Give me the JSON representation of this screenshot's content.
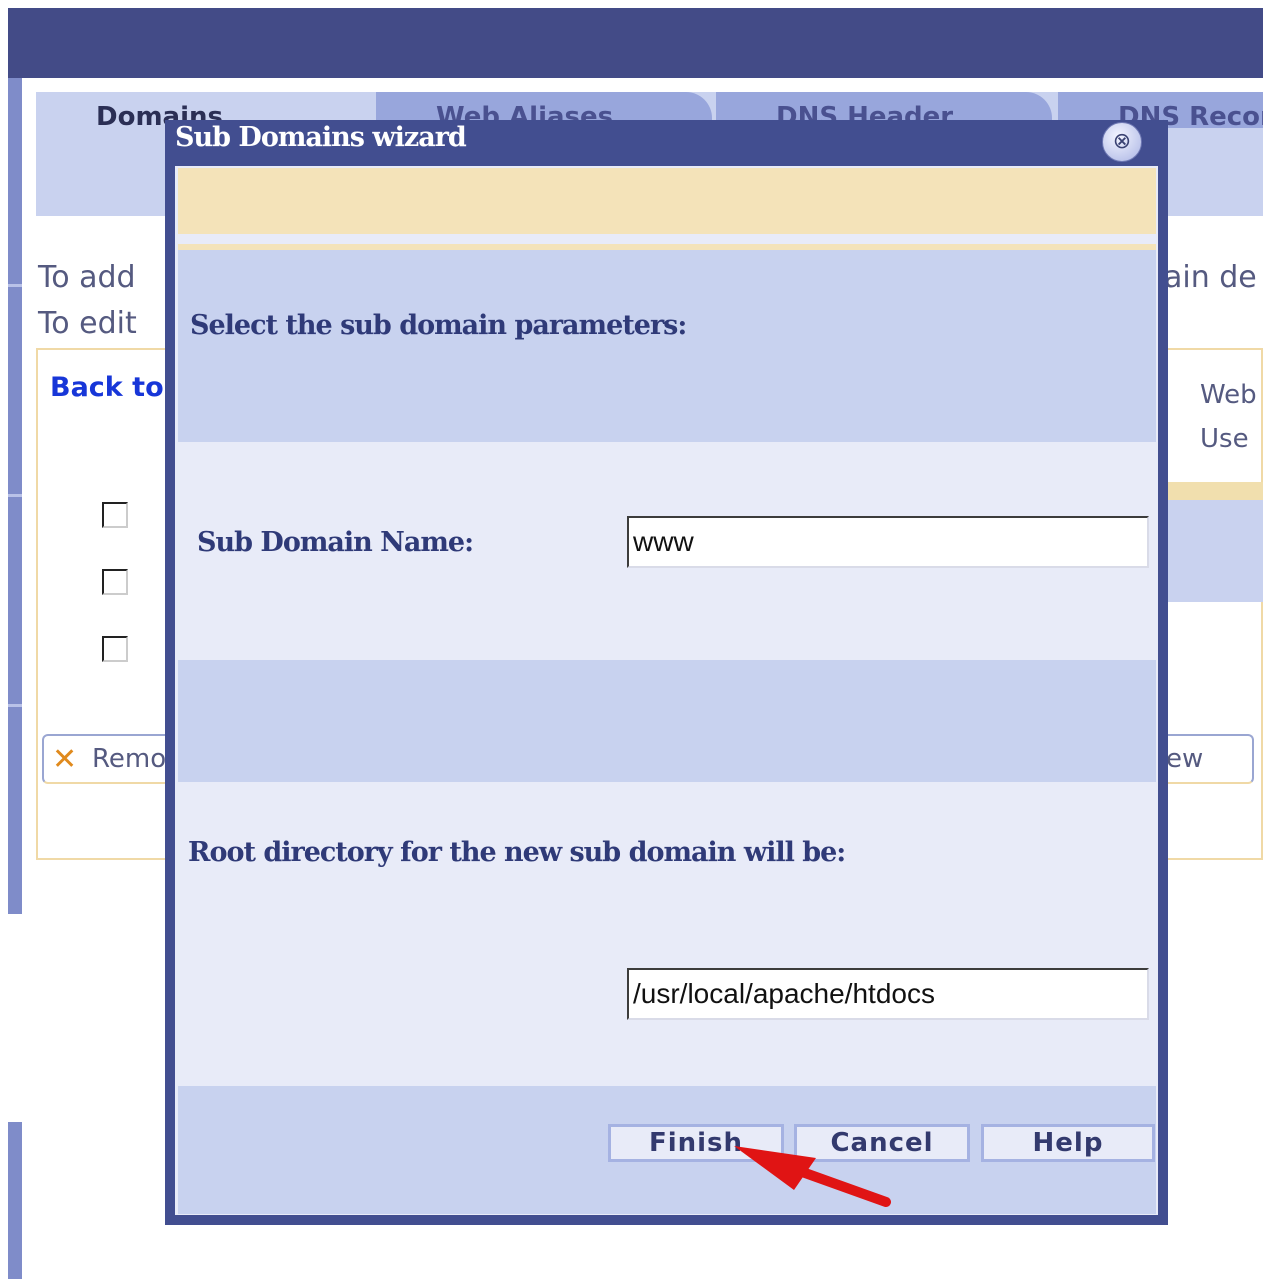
{
  "background": {
    "tabs": [
      {
        "label": "Domains"
      },
      {
        "label": "Web Aliases"
      },
      {
        "label": "DNS Header"
      },
      {
        "label": "DNS Records"
      }
    ],
    "instruction_line_1": "To add",
    "instruction_line_1_right": "ain de",
    "instruction_line_2": "To edit",
    "back_link": "Back to",
    "right_text_1": "Web",
    "right_text_2": "Use",
    "remove_label": "Remo",
    "view_label": "ew"
  },
  "dialog": {
    "title": "Sub Domains wizard",
    "close_glyph": "⊗",
    "section_heading": "Select the sub domain parameters:",
    "subdomain_label": "Sub Domain Name:",
    "subdomain_value": "www",
    "root_label": "Root directory for the new sub domain will be:",
    "root_value": "/usr/local/apache/htdocs",
    "buttons": {
      "finish": "Finish",
      "cancel": "Cancel",
      "help": "Help"
    }
  },
  "annotation": {
    "arrow_color": "#e01414"
  }
}
